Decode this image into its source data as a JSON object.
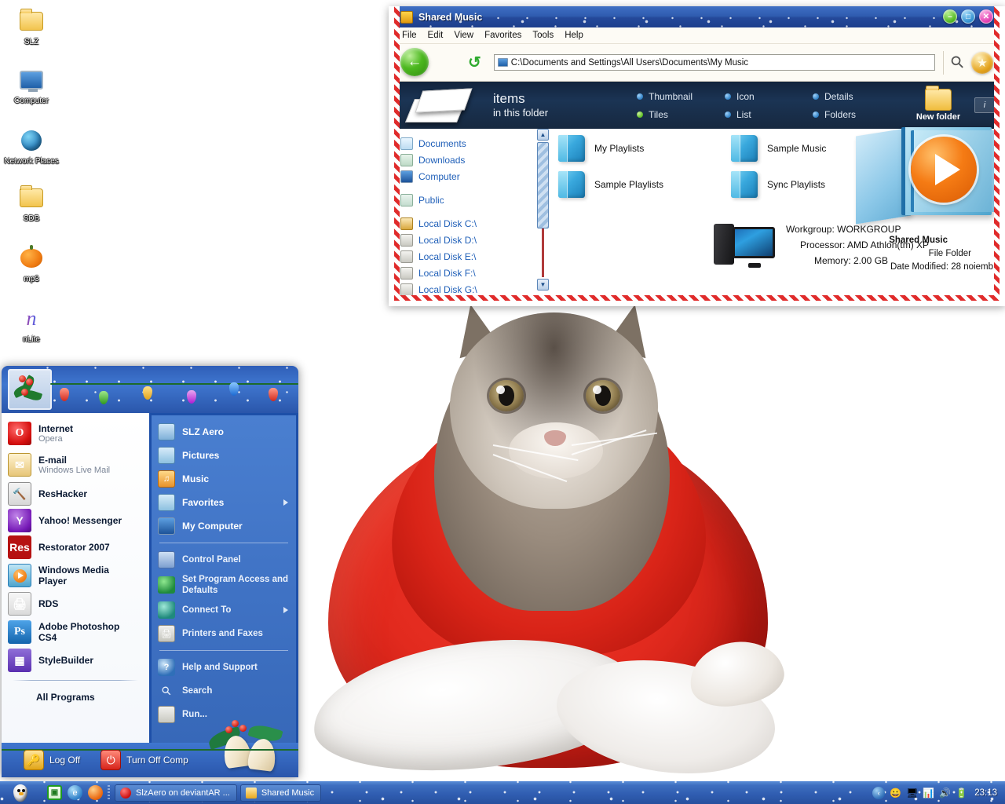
{
  "desktop": {
    "icons": [
      {
        "label": "SLZ",
        "icon": "folder-icon"
      },
      {
        "label": "Computer",
        "icon": "computer-icon"
      },
      {
        "label": "Network Places",
        "icon": "network-globe-icon"
      },
      {
        "label": "SDB",
        "icon": "folder-icon"
      },
      {
        "label": "mp3",
        "icon": "pumpkin-icon"
      },
      {
        "label": "nLite",
        "icon": "nlite-icon"
      }
    ]
  },
  "explorer": {
    "title": "Shared Music",
    "window_buttons": {
      "minimize": "–",
      "maximize": "□",
      "close": "✕"
    },
    "menu": [
      "File",
      "Edit",
      "View",
      "Favorites",
      "Tools",
      "Help"
    ],
    "toolbar": {
      "back": "←",
      "refresh": "↺",
      "address": "C:\\Documents and Settings\\All Users\\Documents\\My Music",
      "search_icon": "search-icon",
      "favorites_icon": "star-icon"
    },
    "infobar": {
      "count_line1": "items",
      "count_line2": "in this folder",
      "views": [
        {
          "label": "Thumbnail",
          "selected": false
        },
        {
          "label": "Icon",
          "selected": false
        },
        {
          "label": "Details",
          "selected": false
        },
        {
          "label": "Tiles",
          "selected": true
        },
        {
          "label": "List",
          "selected": false
        },
        {
          "label": "Folders",
          "selected": false
        }
      ],
      "new_folder": "New folder",
      "info_badge": "i"
    },
    "nav": [
      {
        "label": "Documents",
        "icon": "documents-icon"
      },
      {
        "label": "Downloads",
        "icon": "downloads-icon"
      },
      {
        "label": "Computer",
        "icon": "computer-icon"
      },
      {
        "label": "Public",
        "icon": "public-icon"
      },
      {
        "label": "Local Disk C:\\",
        "icon": "system-disk-icon"
      },
      {
        "label": "Local Disk D:\\",
        "icon": "disk-icon"
      },
      {
        "label": "Local Disk E:\\",
        "icon": "disk-icon"
      },
      {
        "label": "Local Disk F:\\",
        "icon": "disk-icon"
      },
      {
        "label": "Local Disk G:\\",
        "icon": "disk-icon"
      }
    ],
    "folders": [
      {
        "label": "My Playlists"
      },
      {
        "label": "Sample Music"
      },
      {
        "label": "Sample Playlists"
      },
      {
        "label": "Sync Playlists"
      }
    ],
    "system_info": {
      "workgroup": "Workgroup: WORKGROUP",
      "processor": "Processor: AMD Athlon(tm) XP",
      "memory": "Memory: 2.00 GB"
    },
    "details": {
      "name": "Shared Music",
      "type": "File Folder",
      "date_modified": "Date Modified: 28 noiemb"
    }
  },
  "start_menu": {
    "left_items": [
      {
        "name": "Internet",
        "sub": "Opera",
        "icon": "opera-icon"
      },
      {
        "name": "E-mail",
        "sub": "Windows Live Mail",
        "icon": "mail-icon"
      },
      {
        "name": "ResHacker",
        "sub": "",
        "icon": "reshacker-icon"
      },
      {
        "name": "Yahoo! Messenger",
        "sub": "",
        "icon": "yahoo-icon"
      },
      {
        "name": "Restorator 2007",
        "sub": "",
        "icon": "restorator-icon"
      },
      {
        "name": "Windows Media Player",
        "sub": "",
        "icon": "wmp-icon"
      },
      {
        "name": "RDS",
        "sub": "",
        "icon": "rds-icon"
      },
      {
        "name": "Adobe Photoshop CS4",
        "sub": "",
        "icon": "photoshop-icon"
      },
      {
        "name": "StyleBuilder",
        "sub": "",
        "icon": "stylebuilder-icon"
      }
    ],
    "all_programs": "All Programs",
    "right_items_top": [
      {
        "label": "SLZ Aero",
        "icon": "slz-aero-icon",
        "arrow": false
      },
      {
        "label": "Pictures",
        "icon": "pictures-icon",
        "arrow": false
      },
      {
        "label": "Music",
        "icon": "music-icon",
        "arrow": false
      },
      {
        "label": "Favorites",
        "icon": "favorites-icon",
        "arrow": true
      },
      {
        "label": "My Computer",
        "icon": "my-computer-icon",
        "arrow": false
      }
    ],
    "right_items_mid": [
      {
        "label": "Control Panel",
        "icon": "control-panel-icon",
        "arrow": false
      },
      {
        "label": "Set Program Access and Defaults",
        "icon": "set-program-access-icon",
        "arrow": false
      },
      {
        "label": "Connect To",
        "icon": "connect-to-icon",
        "arrow": true
      },
      {
        "label": "Printers and Faxes",
        "icon": "printers-icon",
        "arrow": false
      }
    ],
    "right_items_bottom": [
      {
        "label": "Help and Support",
        "icon": "help-icon",
        "arrow": false
      },
      {
        "label": "Search",
        "icon": "search-icon",
        "arrow": false
      },
      {
        "label": "Run...",
        "icon": "run-icon",
        "arrow": false
      }
    ],
    "footer": {
      "log_off": "Log Off",
      "turn_off": "Turn Off Comp"
    }
  },
  "taskbar": {
    "start_icon": "penguin-start-icon",
    "quicklaunch": [
      {
        "icon": "show-desktop-icon",
        "label": "⬜"
      },
      {
        "icon": "internet-explorer-icon",
        "label": "e"
      },
      {
        "icon": "firefox-icon",
        "label": ""
      }
    ],
    "tasks": [
      {
        "label": "SlzAero on deviantAR ...",
        "icon": "opera-task-icon"
      },
      {
        "label": "Shared Music",
        "icon": "folder-task-icon"
      }
    ],
    "tray": {
      "chevron": "‹",
      "icons": [
        "yahoo-tray-icon",
        "network-tray-icon",
        "signal-tray-icon",
        "volume-tray-icon",
        "battery-tray-icon"
      ],
      "time": "23:13"
    }
  },
  "colors": {
    "accent": "#2f5cb0",
    "infobar_bg": "#16283f",
    "candy_red": "#e02b2b",
    "link_blue": "#1f5fb8"
  }
}
